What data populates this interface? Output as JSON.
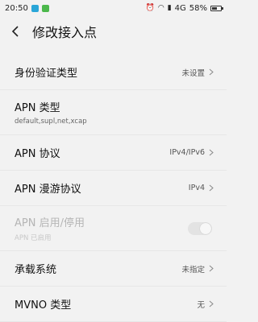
{
  "status_bar": {
    "time": "20:50",
    "network": "4G",
    "battery": "58%",
    "battery_level": 0.58
  },
  "header": {
    "title": "修改接入点",
    "back_icon": "chevron-left-icon"
  },
  "settings": [
    {
      "label": "身份验证类型",
      "value": "未设置",
      "type": "chevron"
    },
    {
      "label": "APN 类型",
      "sub": "default,supl,net,xcap",
      "type": "plain"
    },
    {
      "label": "APN 协议",
      "value": "IPv4/IPv6",
      "type": "chevron"
    },
    {
      "label": "APN 漫游协议",
      "value": "IPv4",
      "type": "chevron"
    },
    {
      "label": "APN 启用/停用",
      "sub": "APN 已启用",
      "type": "toggle",
      "enabled": false
    },
    {
      "label": "承载系统",
      "value": "未指定",
      "type": "chevron"
    },
    {
      "label": "MVNO 类型",
      "value": "无",
      "type": "chevron"
    }
  ]
}
